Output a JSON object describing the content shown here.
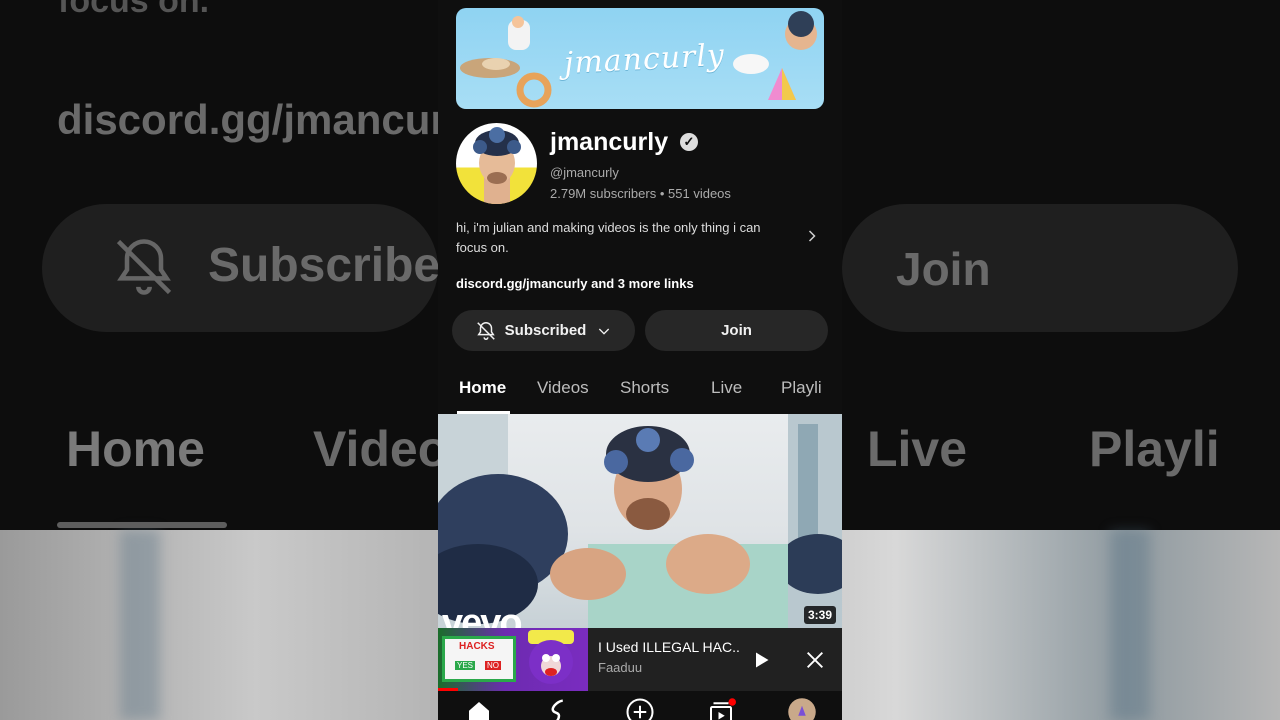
{
  "channel": {
    "banner_text": "jmancurly",
    "name": "jmancurly",
    "handle": "@jmancurly",
    "subscribers": "2.79M subscribers",
    "separator": "•",
    "videos_count": "551 videos",
    "description": "hi, i'm julian and making videos is the only thing i can focus on.",
    "links": "discord.gg/jmancurly and 3 more links"
  },
  "actions": {
    "subscribed_label": "Subscribed",
    "join_label": "Join"
  },
  "tabs": [
    {
      "label": "Home",
      "active": true
    },
    {
      "label": "Videos"
    },
    {
      "label": "Shorts"
    },
    {
      "label": "Live"
    },
    {
      "label": "Playli"
    }
  ],
  "featured_video": {
    "duration": "3:39",
    "watermark": "vevo"
  },
  "miniplayer": {
    "title": "I Used ILLEGAL HAC..",
    "author": "Faaduu",
    "thumb_text_main": "HACKS",
    "thumb_text_yes": "YES",
    "thumb_text_no": "NO"
  },
  "bottom_nav": {
    "icons": [
      "home-icon",
      "shorts-icon",
      "create-icon",
      "subscriptions-icon",
      "profile-avatar"
    ],
    "subscriptions_badge_color": "#ff0000"
  },
  "background": {
    "desc_tail": "focus on.",
    "links_text": "discord.gg/jmancur",
    "subscribed_label": "Subscribe",
    "join_label": "Join",
    "tabs": [
      "Home",
      "Video",
      "Live",
      "Playli"
    ]
  },
  "colors": {
    "app_bg": "#0f0f0f",
    "button_bg": "#272727",
    "banner_bg": "#a8def5"
  }
}
